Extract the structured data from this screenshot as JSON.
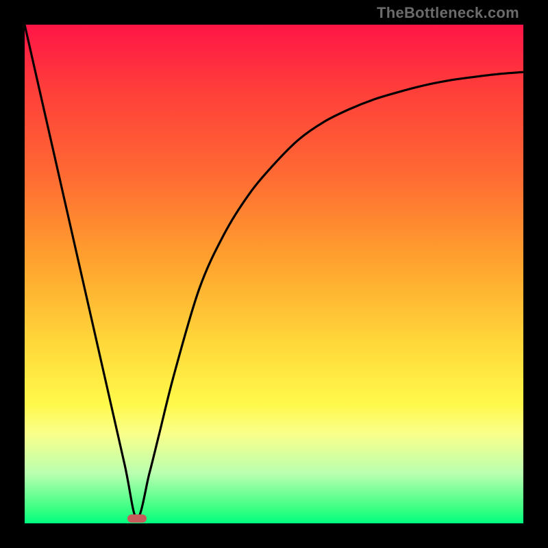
{
  "watermark": "TheBottleneck.com",
  "chart_data": {
    "type": "line",
    "title": "",
    "xlabel": "",
    "ylabel": "",
    "xlim": [
      0,
      100
    ],
    "ylim": [
      0,
      100
    ],
    "grid": false,
    "legend": false,
    "series": [
      {
        "name": "curve",
        "x": [
          0,
          5,
          10,
          15,
          20,
          22.5,
          25,
          27,
          30,
          35,
          40,
          45,
          50,
          55,
          60,
          65,
          70,
          75,
          80,
          85,
          90,
          95,
          100
        ],
        "y": [
          100,
          78,
          56,
          34,
          12,
          1,
          10,
          18,
          30,
          47,
          58,
          66,
          72,
          77,
          80.5,
          83,
          85,
          86.5,
          87.8,
          88.8,
          89.5,
          90.1,
          90.5
        ]
      }
    ],
    "markers": [
      {
        "name": "optimal-point",
        "x": 22.5,
        "y": 1,
        "color": "#c55b5b"
      }
    ],
    "background_gradient": {
      "direction": "vertical",
      "stops": [
        {
          "pos": 0,
          "color": "#ff1547"
        },
        {
          "pos": 12,
          "color": "#ff3b3b"
        },
        {
          "pos": 30,
          "color": "#ff6a33"
        },
        {
          "pos": 48,
          "color": "#ffa42e"
        },
        {
          "pos": 64,
          "color": "#ffd83a"
        },
        {
          "pos": 76,
          "color": "#fff94a"
        },
        {
          "pos": 82,
          "color": "#faff8a"
        },
        {
          "pos": 90,
          "color": "#b9ffb0"
        },
        {
          "pos": 97,
          "color": "#3cff83"
        },
        {
          "pos": 100,
          "color": "#00ff80"
        }
      ]
    }
  }
}
